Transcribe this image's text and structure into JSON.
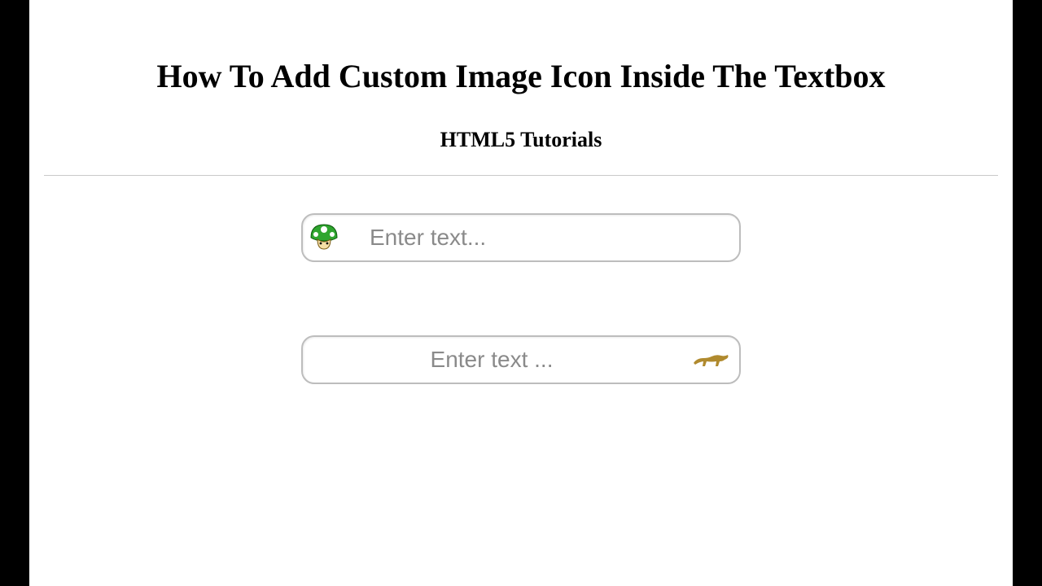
{
  "heading": {
    "title": "How To Add Custom Image Icon Inside The Textbox",
    "subtitle": "HTML5 Tutorials"
  },
  "inputs": {
    "first": {
      "placeholder": "Enter text...",
      "icon_name": "mushroom-icon"
    },
    "second": {
      "placeholder": "Enter text ...",
      "icon_name": "leopard-icon"
    }
  },
  "colors": {
    "border": "#bdbdbd",
    "placeholder": "#8a8a8a",
    "mushroom_cap": "#2fa52f",
    "mushroom_spot": "#ffffff",
    "mushroom_face": "#f6dfa6",
    "leopard": "#b08a2e"
  }
}
